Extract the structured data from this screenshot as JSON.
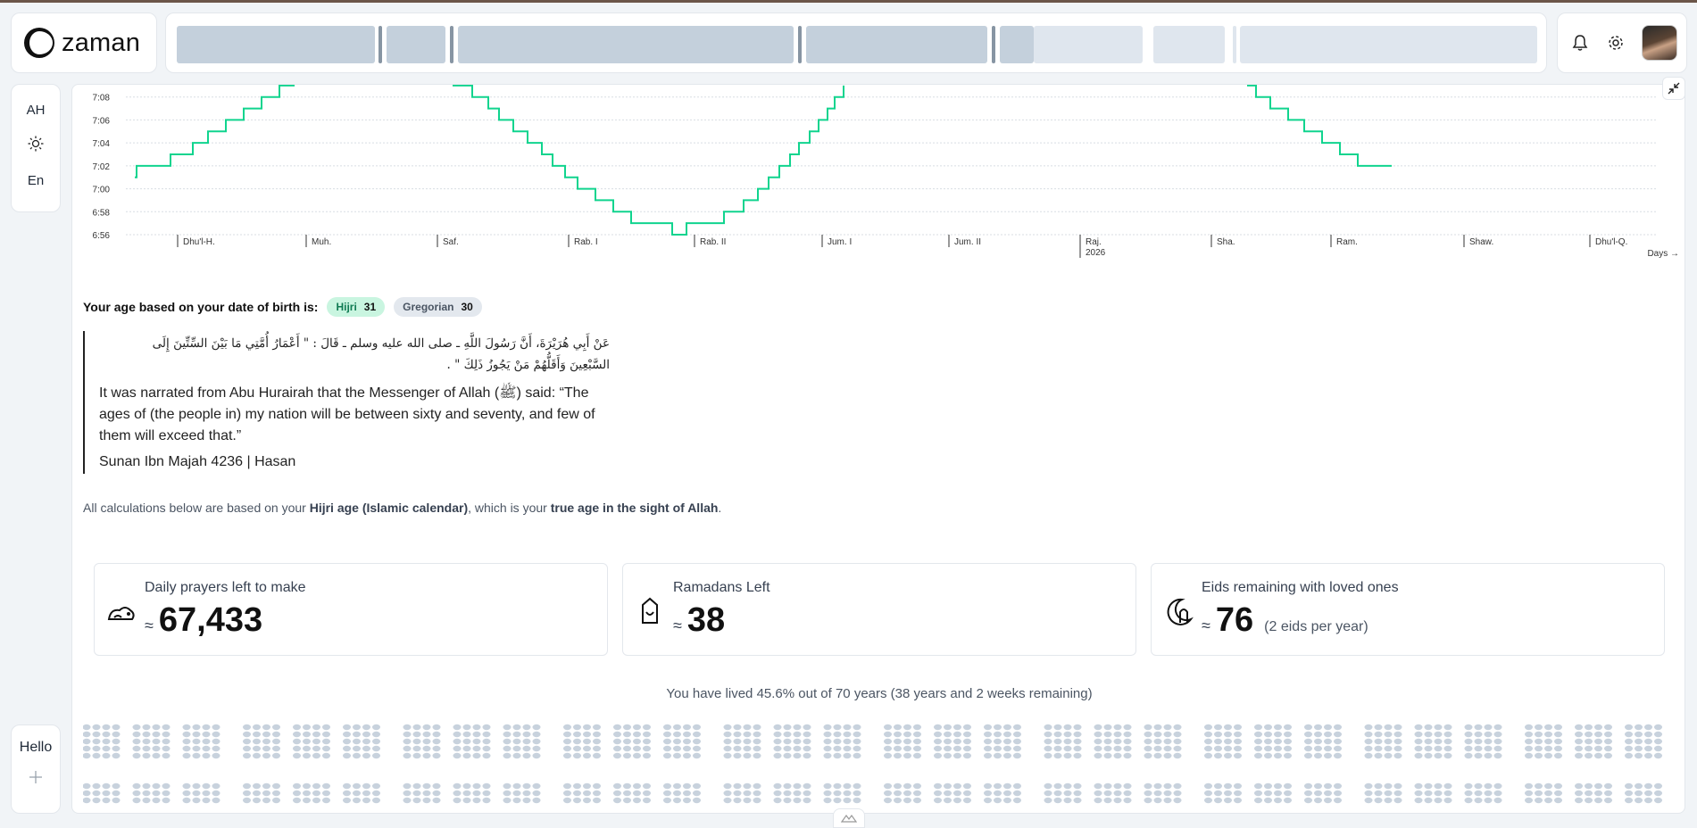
{
  "app": {
    "name": "zaman"
  },
  "sidebar": {
    "calendar_toggle": "AH",
    "language_toggle": "En",
    "profile_label": "Hello"
  },
  "chart_data": {
    "type": "line",
    "xlabel": "Days →",
    "y_ticks": [
      "7:08",
      "7:06",
      "7:04",
      "7:02",
      "7:00",
      "6:58",
      "6:56"
    ],
    "ylim": [
      "6:56",
      "7:10"
    ],
    "x_ticks": [
      "Dhu'l-H.",
      "Muh.",
      "Saf.",
      "Rab. I",
      "Rab. II",
      "Jum. I",
      "Jum. II",
      "Raj. 2026",
      "Sha.",
      "Ram.",
      "Shaw.",
      "Dhu'l-Q."
    ],
    "x_tick_year": "2026",
    "series": [
      {
        "color": "#10d48e",
        "points": [
          [
            "Dhu'l-H.",
            "7:01"
          ],
          [
            "Dhu'l-H.",
            "7:02"
          ],
          [
            "Muh.",
            "7:03"
          ],
          [
            "Muh.",
            "7:04"
          ],
          [
            "Muh.",
            "7:05"
          ],
          [
            "Muh.",
            "7:06"
          ],
          [
            "Muh.",
            "7:07"
          ],
          [
            "Muh.",
            "7:08"
          ],
          [
            "Muh.",
            "7:09"
          ],
          [
            "Saf.",
            "7:10"
          ],
          [
            "Rab. I",
            "7:09"
          ],
          [
            "Rab. I",
            "7:08"
          ],
          [
            "Rab. I",
            "7:07"
          ],
          [
            "Rab. I",
            "7:06"
          ],
          [
            "Rab. I",
            "7:05"
          ],
          [
            "Rab. II",
            "7:04"
          ],
          [
            "Rab. II",
            "7:03"
          ],
          [
            "Rab. II",
            "7:02"
          ],
          [
            "Rab. II",
            "7:01"
          ],
          [
            "Rab. II",
            "7:00"
          ],
          [
            "Rab. II",
            "6:59"
          ],
          [
            "Rab. II",
            "6:58"
          ],
          [
            "Rab. II",
            "6:57"
          ],
          [
            "Jum. I",
            "6:56"
          ],
          [
            "Jum. I",
            "6:57"
          ],
          [
            "Jum. I",
            "6:58"
          ],
          [
            "Jum. II",
            "6:59"
          ],
          [
            "Jum. II",
            "7:00"
          ],
          [
            "Jum. II",
            "7:01"
          ],
          [
            "Jum. II",
            "7:02"
          ],
          [
            "Jum. II",
            "7:03"
          ],
          [
            "Jum. II",
            "7:04"
          ],
          [
            "Jum. II",
            "7:05"
          ],
          [
            "Jum. II",
            "7:06"
          ],
          [
            "Jum. II",
            "7:07"
          ],
          [
            "Jum. II",
            "7:08"
          ],
          [
            "Jum. II",
            "7:09"
          ],
          [
            "Shaw.",
            "7:09"
          ],
          [
            "Shaw.",
            "7:08"
          ],
          [
            "Shaw.",
            "7:07"
          ],
          [
            "Shaw.",
            "7:06"
          ],
          [
            "Shaw.",
            "7:05"
          ],
          [
            "Shaw.",
            "7:04"
          ],
          [
            "Dhu'l-Q.",
            "7:03"
          ],
          [
            "Dhu'l-Q.",
            "7:02"
          ]
        ]
      }
    ],
    "grid": true
  },
  "age": {
    "prefix": "Your age based on your date of birth is:",
    "hijri_label": "Hijri",
    "hijri_value": "31",
    "gregorian_label": "Gregorian",
    "gregorian_value": "30"
  },
  "hadith": {
    "arabic_line1": "عَنْ أَبِي هُرَيْرَةَ، أَنَّ رَسُولَ اللَّهِ ـ صلى الله عليه وسلم ـ قَالَ : \" أَعْمَارُ أُمَّتِي مَا بَيْنَ السِّتِّينَ إِلَى",
    "arabic_line2": "السَّبْعِينَ وَأَقَلُّهُمْ مَنْ يَجُوزُ ذَلِكَ \" .",
    "english": "It was narrated from Abu Hurairah that the Messenger of Allah (ﷺ) said: “The ages of (the people in) my nation will be between sixty and seventy, and few of them will exceed that.”",
    "source": "Sunan Ibn Majah 4236 | Hasan"
  },
  "calc_note": {
    "before": "All calculations below are based on your ",
    "bold1": "Hijri age (Islamic calendar)",
    "middle": ", which is your ",
    "bold2": "true age in the sight of Allah",
    "after": "."
  },
  "stats": [
    {
      "label": "Daily prayers left to make",
      "approx": "≈",
      "value": "67,433",
      "note": "",
      "icon": "prayer-mat-icon"
    },
    {
      "label": "Ramadans Left",
      "approx": "≈",
      "value": "38",
      "note": "",
      "icon": "lantern-icon"
    },
    {
      "label": "Eids remaining with loved ones",
      "approx": "≈",
      "value": "76",
      "note": "(2 eids per year)",
      "icon": "crescent-mosque-icon"
    }
  ],
  "lived_text": "You have lived 45.6% out of 70 years (38 years and 2 weeks remaining)",
  "life_progress": {
    "lived_fraction": 0.456,
    "total_years": 70
  }
}
